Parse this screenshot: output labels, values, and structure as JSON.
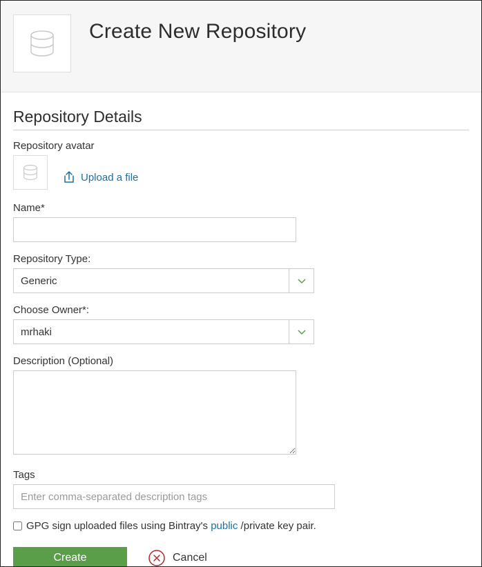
{
  "header": {
    "title": "Create New Repository"
  },
  "section": {
    "title": "Repository Details"
  },
  "avatar": {
    "label": "Repository avatar",
    "upload_text": "Upload a file"
  },
  "name": {
    "label": "Name*",
    "value": ""
  },
  "repo_type": {
    "label": "Repository Type:",
    "value": "Generic"
  },
  "owner": {
    "label": "Choose Owner*:",
    "value": "mrhaki"
  },
  "description": {
    "label": "Description (Optional)",
    "value": ""
  },
  "tags": {
    "label": "Tags",
    "placeholder": "Enter comma-separated description tags",
    "value": ""
  },
  "gpg": {
    "prefix": "GPG sign uploaded files using Bintray's ",
    "link": "public",
    "suffix": " /private key pair."
  },
  "actions": {
    "create": "Create",
    "cancel": "Cancel"
  }
}
